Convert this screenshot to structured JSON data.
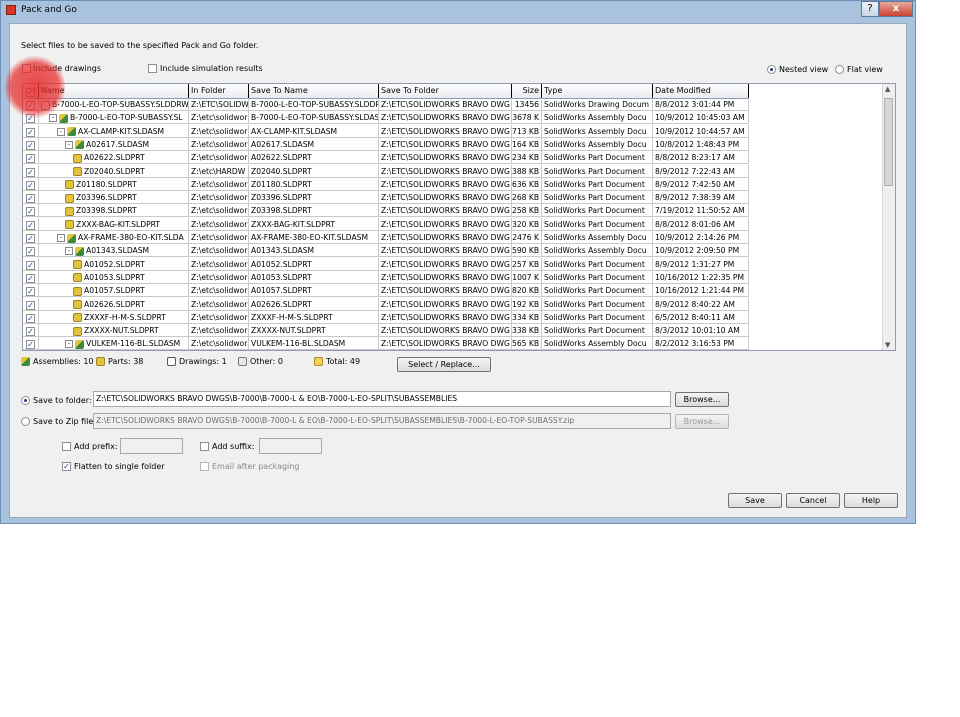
{
  "window": {
    "title": "Pack and Go",
    "close_glyph": "x",
    "help_glyph": "?"
  },
  "instruction": "Select files to be saved to the specified Pack and Go folder.",
  "options": {
    "include_drawings": "Include drawings",
    "include_simulation": "Include simulation results",
    "nested_view": "Nested view",
    "flat_view": "Flat view"
  },
  "table": {
    "headers": [
      "Name",
      "In Folder",
      "Save To Name",
      "Save To Folder",
      "Size",
      "Type",
      "Date Modified"
    ],
    "rows": [
      {
        "indent": 0,
        "icon": "drw",
        "expander": "",
        "name": "B-7000-L-EO-TOP-SUBASSY.SLDDRW",
        "in_folder": "Z:\\ETC\\SOLIDW",
        "save_name": "B-7000-L-EO-TOP-SUBASSY.SLDDR",
        "save_folder": "Z:\\ETC\\SOLIDWORKS BRAVO DWG",
        "size": "13456",
        "type": "SolidWorks Drawing Docum",
        "date": "8/8/2012 3:01:44 PM"
      },
      {
        "indent": 1,
        "icon": "asm",
        "expander": "-",
        "name": "B-7000-L-EO-TOP-SUBASSY.SL",
        "in_folder": "Z:\\etc\\solidwor",
        "save_name": "B-7000-L-EO-TOP-SUBASSY.SLDAS",
        "save_folder": "Z:\\ETC\\SOLIDWORKS BRAVO DWG",
        "size": "3678 K",
        "type": "SolidWorks Assembly Docu",
        "date": "10/9/2012 10:45:03 AM"
      },
      {
        "indent": 2,
        "icon": "asm",
        "expander": "-",
        "name": "AX-CLAMP-KIT.SLDASM",
        "in_folder": "Z:\\etc\\solidwor",
        "save_name": "AX-CLAMP-KIT.SLDASM",
        "save_folder": "Z:\\ETC\\SOLIDWORKS BRAVO DWG",
        "size": "713 KB",
        "type": "SolidWorks Assembly Docu",
        "date": "10/9/2012 10:44:57 AM"
      },
      {
        "indent": 3,
        "icon": "asm",
        "expander": "-",
        "name": "A02617.SLDASM",
        "in_folder": "Z:\\etc\\solidwor",
        "save_name": "A02617.SLDASM",
        "save_folder": "Z:\\ETC\\SOLIDWORKS BRAVO DWG",
        "size": "164 KB",
        "type": "SolidWorks Assembly Docu",
        "date": "10/8/2012 1:48:43 PM"
      },
      {
        "indent": 4,
        "icon": "part",
        "expander": "",
        "name": "A02622.SLDPRT",
        "in_folder": "Z:\\etc\\solidwor",
        "save_name": "A02622.SLDPRT",
        "save_folder": "Z:\\ETC\\SOLIDWORKS BRAVO DWG",
        "size": "234 KB",
        "type": "SolidWorks Part Document",
        "date": "8/8/2012 8:23:17 AM"
      },
      {
        "indent": 4,
        "icon": "part",
        "expander": "",
        "name": "Z02040.SLDPRT",
        "in_folder": "Z:\\etc\\HARDW",
        "save_name": "Z02040.SLDPRT",
        "save_folder": "Z:\\ETC\\SOLIDWORKS BRAVO DWG",
        "size": "388 KB",
        "type": "SolidWorks Part Document",
        "date": "8/9/2012 7:22:43 AM"
      },
      {
        "indent": 3,
        "icon": "part",
        "expander": "",
        "name": "Z01180.SLDPRT",
        "in_folder": "Z:\\etc\\solidwor",
        "save_name": "Z01180.SLDPRT",
        "save_folder": "Z:\\ETC\\SOLIDWORKS BRAVO DWG",
        "size": "636 KB",
        "type": "SolidWorks Part Document",
        "date": "8/9/2012 7:42:50 AM"
      },
      {
        "indent": 3,
        "icon": "part",
        "expander": "",
        "name": "Z03396.SLDPRT",
        "in_folder": "Z:\\etc\\solidwor",
        "save_name": "Z03396.SLDPRT",
        "save_folder": "Z:\\ETC\\SOLIDWORKS BRAVO DWG",
        "size": "268 KB",
        "type": "SolidWorks Part Document",
        "date": "8/9/2012 7:38:39 AM"
      },
      {
        "indent": 3,
        "icon": "part",
        "expander": "",
        "name": "Z03398.SLDPRT",
        "in_folder": "Z:\\etc\\solidwor",
        "save_name": "Z03398.SLDPRT",
        "save_folder": "Z:\\ETC\\SOLIDWORKS BRAVO DWG",
        "size": "258 KB",
        "type": "SolidWorks Part Document",
        "date": "7/19/2012 11:50:52 AM"
      },
      {
        "indent": 3,
        "icon": "part",
        "expander": "",
        "name": "ZXXX-BAG-KIT.SLDPRT",
        "in_folder": "Z:\\etc\\solidwor",
        "save_name": "ZXXX-BAG-KIT.SLDPRT",
        "save_folder": "Z:\\ETC\\SOLIDWORKS BRAVO DWG",
        "size": "320 KB",
        "type": "SolidWorks Part Document",
        "date": "8/8/2012 8:01:06 AM"
      },
      {
        "indent": 2,
        "icon": "asm",
        "expander": "-",
        "name": "AX-FRAME-380-EO-KIT.SLDA",
        "in_folder": "Z:\\etc\\solidwor",
        "save_name": "AX-FRAME-380-EO-KIT.SLDASM",
        "save_folder": "Z:\\ETC\\SOLIDWORKS BRAVO DWG",
        "size": "2476 K",
        "type": "SolidWorks Assembly Docu",
        "date": "10/9/2012 2:14:26 PM"
      },
      {
        "indent": 3,
        "icon": "asm",
        "expander": "-",
        "name": "A01343.SLDASM",
        "in_folder": "Z:\\etc\\solidwor",
        "save_name": "A01343.SLDASM",
        "save_folder": "Z:\\ETC\\SOLIDWORKS BRAVO DWG",
        "size": "590 KB",
        "type": "SolidWorks Assembly Docu",
        "date": "10/9/2012 2:09:50 PM"
      },
      {
        "indent": 4,
        "icon": "part",
        "expander": "",
        "name": "A01052.SLDPRT",
        "in_folder": "Z:\\etc\\solidwor",
        "save_name": "A01052.SLDPRT",
        "save_folder": "Z:\\ETC\\SOLIDWORKS BRAVO DWG",
        "size": "257 KB",
        "type": "SolidWorks Part Document",
        "date": "8/9/2012 1:31:27 PM"
      },
      {
        "indent": 4,
        "icon": "part",
        "expander": "",
        "name": "A01053.SLDPRT",
        "in_folder": "Z:\\etc\\solidwor",
        "save_name": "A01053.SLDPRT",
        "save_folder": "Z:\\ETC\\SOLIDWORKS BRAVO DWG",
        "size": "1007 K",
        "type": "SolidWorks Part Document",
        "date": "10/16/2012 1:22:35 PM"
      },
      {
        "indent": 4,
        "icon": "part",
        "expander": "",
        "name": "A01057.SLDPRT",
        "in_folder": "Z:\\etc\\solidwor",
        "save_name": "A01057.SLDPRT",
        "save_folder": "Z:\\ETC\\SOLIDWORKS BRAVO DWG",
        "size": "820 KB",
        "type": "SolidWorks Part Document",
        "date": "10/16/2012 1:21:44 PM"
      },
      {
        "indent": 4,
        "icon": "part",
        "expander": "",
        "name": "A02626.SLDPRT",
        "in_folder": "Z:\\etc\\solidwor",
        "save_name": "A02626.SLDPRT",
        "save_folder": "Z:\\ETC\\SOLIDWORKS BRAVO DWG",
        "size": "192 KB",
        "type": "SolidWorks Part Document",
        "date": "8/9/2012 8:40:22 AM"
      },
      {
        "indent": 4,
        "icon": "part",
        "expander": "",
        "name": "ZXXXF-H-M-S.SLDPRT",
        "in_folder": "Z:\\etc\\solidwor",
        "save_name": "ZXXXF-H-M-S.SLDPRT",
        "save_folder": "Z:\\ETC\\SOLIDWORKS BRAVO DWG",
        "size": "334 KB",
        "type": "SolidWorks Part Document",
        "date": "6/5/2012 8:40:11 AM"
      },
      {
        "indent": 4,
        "icon": "part",
        "expander": "",
        "name": "ZXXXX-NUT.SLDPRT",
        "in_folder": "Z:\\etc\\solidwor",
        "save_name": "ZXXXX-NUT.SLDPRT",
        "save_folder": "Z:\\ETC\\SOLIDWORKS BRAVO DWG",
        "size": "338 KB",
        "type": "SolidWorks Part Document",
        "date": "8/3/2012 10:01:10 AM"
      },
      {
        "indent": 3,
        "icon": "asm",
        "expander": "-",
        "name": "VULKEM-116-BL.SLDASM",
        "in_folder": "Z:\\etc\\solidwor",
        "save_name": "VULKEM-116-BL.SLDASM",
        "save_folder": "Z:\\ETC\\SOLIDWORKS BRAVO DWG",
        "size": "565 KB",
        "type": "SolidWorks Assembly Docu",
        "date": "8/2/2012 3:16:53 PM"
      }
    ]
  },
  "summary": {
    "assemblies": "Assemblies: 10",
    "parts": "Parts: 38",
    "drawings": "Drawings: 1",
    "other": "Other: 0",
    "total": "Total: 49",
    "select_replace": "Select / Replace..."
  },
  "save": {
    "to_folder_label": "Save to folder:",
    "to_folder_value": "Z:\\ETC\\SOLIDWORKS BRAVO DWGS\\B-7000\\B-7000-L & EO\\B-7000-L-EO-SPLIT\\SUBASSEMBLIES",
    "to_zip_label": "Save to Zip file:",
    "to_zip_value": "Z:\\ETC\\SOLIDWORKS BRAVO DWGS\\B-7000\\B-7000-L & EO\\B-7000-L-EO-SPLIT\\SUBASSEMBLIES\\B-7000-L-EO-TOP-SUBASSY.zip",
    "browse": "Browse...",
    "add_prefix": "Add prefix:",
    "add_suffix": "Add suffix:",
    "flatten": "Flatten to single folder",
    "email": "Email after packaging"
  },
  "buttons": {
    "save": "Save",
    "cancel": "Cancel",
    "help": "Help"
  },
  "checkmark": "✓"
}
